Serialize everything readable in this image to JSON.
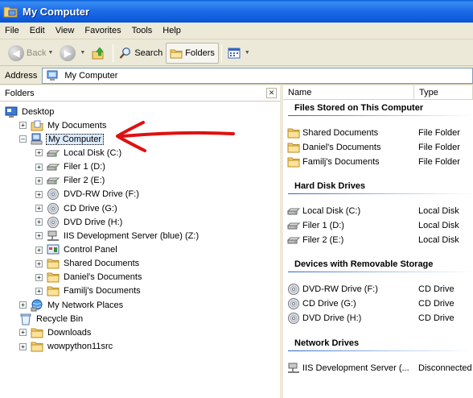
{
  "window": {
    "title": "My Computer"
  },
  "menu": [
    "File",
    "Edit",
    "View",
    "Favorites",
    "Tools",
    "Help"
  ],
  "toolbar": {
    "back": "Back",
    "search": "Search",
    "folders": "Folders"
  },
  "address": {
    "label": "Address",
    "value": "My Computer"
  },
  "folders_pane": {
    "title": "Folders",
    "tree": [
      {
        "label": "Desktop",
        "icon": "desktop-icon",
        "level": 0,
        "expander": ""
      },
      {
        "label": "My Documents",
        "icon": "my-documents-icon",
        "level": 1,
        "expander": "+"
      },
      {
        "label": "My Computer",
        "icon": "my-computer-icon",
        "level": 1,
        "expander": "-",
        "selected": true
      },
      {
        "label": "Local Disk (C:)",
        "icon": "hard-disk-icon",
        "level": 2,
        "expander": "+"
      },
      {
        "label": "Filer 1 (D:)",
        "icon": "hard-disk-icon",
        "level": 2,
        "expander": "+"
      },
      {
        "label": "Filer 2 (E:)",
        "icon": "hard-disk-icon",
        "level": 2,
        "expander": "+"
      },
      {
        "label": "DVD-RW Drive (F:)",
        "icon": "cd-drive-icon",
        "level": 2,
        "expander": "+"
      },
      {
        "label": "CD Drive (G:)",
        "icon": "cd-drive-icon",
        "level": 2,
        "expander": "+"
      },
      {
        "label": "DVD Drive (H:)",
        "icon": "cd-drive-icon",
        "level": 2,
        "expander": "+"
      },
      {
        "label": "IIS Development Server (blue) (Z:)",
        "icon": "network-drive-icon",
        "level": 2,
        "expander": "+"
      },
      {
        "label": "Control Panel",
        "icon": "control-panel-icon",
        "level": 2,
        "expander": "+"
      },
      {
        "label": "Shared Documents",
        "icon": "folder-icon",
        "level": 2,
        "expander": "+"
      },
      {
        "label": "Daniel's Documents",
        "icon": "folder-icon",
        "level": 2,
        "expander": "+"
      },
      {
        "label": "Familj's Documents",
        "icon": "folder-icon",
        "level": 2,
        "expander": "+"
      },
      {
        "label": "My Network Places",
        "icon": "network-places-icon",
        "level": 1,
        "expander": "+"
      },
      {
        "label": "Recycle Bin",
        "icon": "recycle-bin-icon",
        "level": 1,
        "expander": ""
      },
      {
        "label": "Downloads",
        "icon": "folder-icon",
        "level": 1,
        "expander": "+"
      },
      {
        "label": "wowpython11src",
        "icon": "folder-icon",
        "level": 1,
        "expander": "+"
      }
    ]
  },
  "details": {
    "columns": [
      "Name",
      "Type"
    ],
    "groups": [
      {
        "title": "Files Stored on This Computer",
        "items": [
          {
            "name": "Shared Documents",
            "type": "File Folder",
            "icon": "folder-icon"
          },
          {
            "name": "Daniel's Documents",
            "type": "File Folder",
            "icon": "folder-icon"
          },
          {
            "name": "Familj's Documents",
            "type": "File Folder",
            "icon": "folder-icon"
          }
        ]
      },
      {
        "title": "Hard Disk Drives",
        "items": [
          {
            "name": "Local Disk (C:)",
            "type": "Local Disk",
            "icon": "hard-disk-icon"
          },
          {
            "name": "Filer 1 (D:)",
            "type": "Local Disk",
            "icon": "hard-disk-icon"
          },
          {
            "name": "Filer 2 (E:)",
            "type": "Local Disk",
            "icon": "hard-disk-icon"
          }
        ]
      },
      {
        "title": "Devices with Removable Storage",
        "items": [
          {
            "name": "DVD-RW Drive (F:)",
            "type": "CD Drive",
            "icon": "cd-drive-icon"
          },
          {
            "name": "CD Drive (G:)",
            "type": "CD Drive",
            "icon": "cd-drive-icon"
          },
          {
            "name": "DVD Drive (H:)",
            "type": "CD Drive",
            "icon": "cd-drive-icon"
          }
        ]
      },
      {
        "title": "Network Drives",
        "items": [
          {
            "name": "IIS Development Server (...",
            "type": "Disconnected",
            "icon": "network-drive-icon"
          }
        ]
      }
    ]
  },
  "colors": {
    "title_bar": "#0a54d4",
    "selection": "#dcebfb",
    "annotation_arrow": "#e01010",
    "group_rule": "#2c63c7"
  }
}
